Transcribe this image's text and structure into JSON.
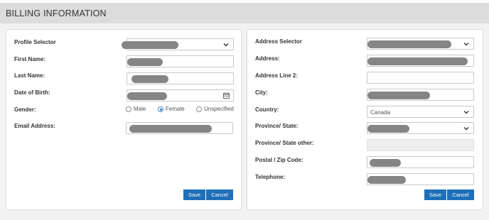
{
  "header": {
    "title": "BILLING INFORMATION"
  },
  "left": {
    "profile_selector_label": "Profile Selector",
    "first_name_label": "First Name:",
    "last_name_label": "Last Name:",
    "dob_label": "Date of Birth:",
    "gender_label": "Gender:",
    "email_label": "Email Address:",
    "gender_options": [
      "Male",
      "Female",
      "Unspecified"
    ],
    "gender_selected": "Female",
    "save_label": "Save",
    "cancel_label": "Cancel"
  },
  "right": {
    "address_selector_label": "Address Selector",
    "address_label": "Address:",
    "address2_label": "Address Line 2:",
    "city_label": "City:",
    "country_label": "Country:",
    "country_value": "Canada",
    "province_label": "Province/ State:",
    "province_other_label": "Province/ State other:",
    "postal_label": "Postal / Zip Code:",
    "telephone_label": "Telephone:",
    "save_label": "Save",
    "cancel_label": "Cancel"
  },
  "icons": {
    "dropdown": "chevron-down-icon",
    "calendar": "calendar-icon"
  },
  "colors": {
    "button": "#1f6fb8",
    "header_bg": "#dcdcdc",
    "redaction": "#858585"
  }
}
